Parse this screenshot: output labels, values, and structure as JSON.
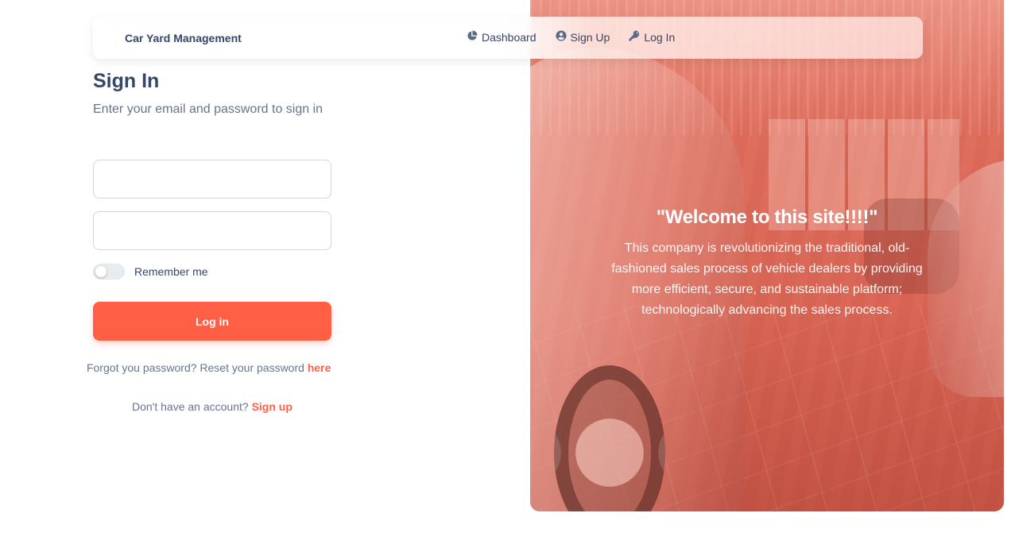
{
  "navbar": {
    "brand": "Car Yard Management",
    "links": [
      {
        "label": "Dashboard",
        "icon": "pie-chart-icon"
      },
      {
        "label": "Sign Up",
        "icon": "user-circle-icon"
      },
      {
        "label": "Log In",
        "icon": "key-icon"
      }
    ]
  },
  "signin": {
    "title": "Sign In",
    "subtitle": "Enter your email and password to sign in",
    "email": {
      "value": "",
      "placeholder": ""
    },
    "password": {
      "value": "",
      "placeholder": ""
    },
    "remember_label": "Remember me",
    "remember_checked": false,
    "login_label": "Log in",
    "forgot_text": "Forgot you password? Reset your password",
    "forgot_link": "here",
    "signup_text": "Don't have an account?",
    "signup_link": "Sign up"
  },
  "hero": {
    "title": "\"Welcome to this site!!!!\"",
    "description": "This company is revolutionizing the traditional, old-fashioned sales process of vehicle dealers by providing more efficient, secure, and sustainable platform; technologically advancing the sales process."
  },
  "colors": {
    "accent": "#ff5f45",
    "text": "#344767",
    "muted": "#67748e",
    "hero_overlay": "#e87664"
  }
}
